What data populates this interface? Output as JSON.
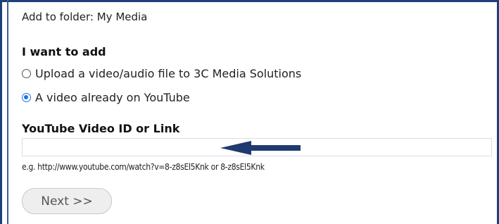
{
  "folder": {
    "text": "Add to folder: My Media"
  },
  "add_section": {
    "heading": "I want to add",
    "options": [
      {
        "label": "Upload a video/audio file to 3C Media Solutions",
        "selected": false
      },
      {
        "label": "A video already on YouTube",
        "selected": true
      }
    ]
  },
  "youtube": {
    "heading": "YouTube Video ID or Link",
    "input_value": "",
    "hint": "e.g. http://www.youtube.com/watch?v=8-z8sEl5Knk or 8-z8sEl5Knk"
  },
  "actions": {
    "next_label": "Next >>"
  },
  "colors": {
    "frame": "#1f3f7a",
    "arrow": "#1f3a6e",
    "radio_selected": "#1a73e8"
  },
  "icons": {
    "arrow": "left-arrow-icon"
  }
}
